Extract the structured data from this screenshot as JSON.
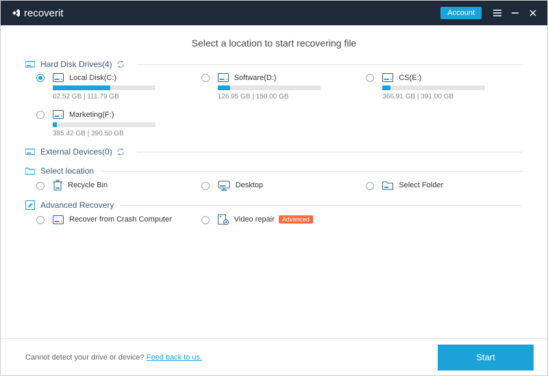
{
  "header": {
    "brand_prefix": "recover",
    "brand_suffix": "it",
    "account_label": "Account"
  },
  "page_title": "Select a location to start recovering file",
  "sections": {
    "drives": {
      "title": "Hard Disk Drives(4)"
    },
    "external": {
      "title": "External Devices(0)"
    },
    "select_location": {
      "title": "Select location"
    },
    "advanced": {
      "title": "Advanced Recovery"
    }
  },
  "drives": [
    {
      "name": "Local Disk(C:)",
      "used": "62.52  GB",
      "total": "111.79  GB",
      "pct": 56,
      "selected": true
    },
    {
      "name": "Software(D:)",
      "used": "126.95  GB",
      "total": "150.00  GB",
      "pct": 12,
      "selected": false
    },
    {
      "name": "CS(E:)",
      "used": "366.91  GB",
      "total": "391.00  GB",
      "pct": 8,
      "selected": false
    },
    {
      "name": "Marketing(F:)",
      "used": "385.42  GB",
      "total": "390.50  GB",
      "pct": 4,
      "selected": false
    }
  ],
  "locations": {
    "recycle": "Recycle Bin",
    "desktop": "Desktop",
    "folder": "Select Folder"
  },
  "advanced": {
    "crash": "Recover from Crash Computer",
    "video": "Video repair",
    "video_badge": "Advanced"
  },
  "footer": {
    "text": "Cannot detect your drive or device? ",
    "link": "Feed back to us.",
    "start": "Start"
  }
}
